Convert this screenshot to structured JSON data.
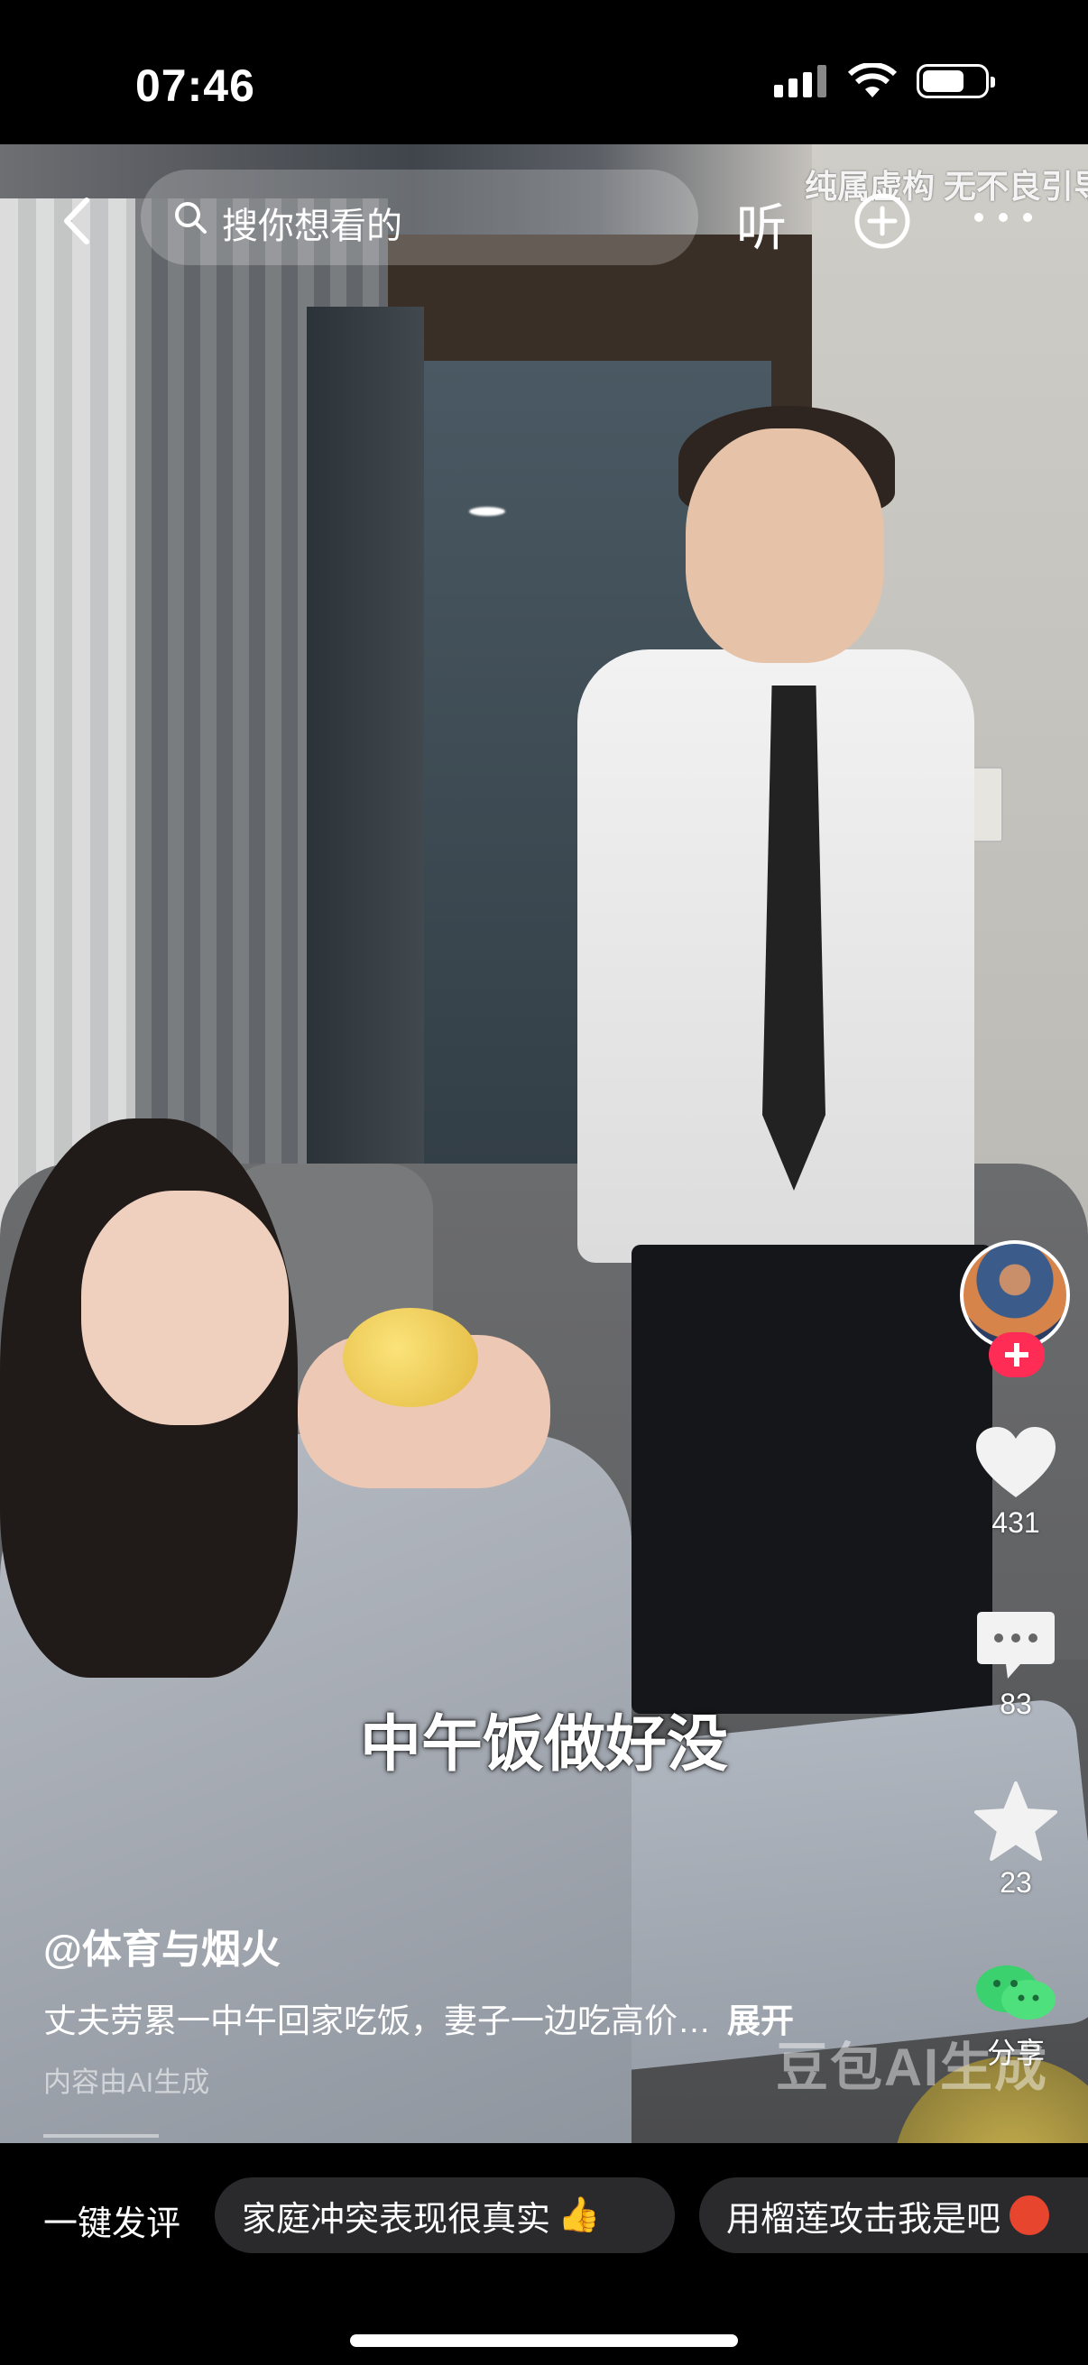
{
  "status_bar": {
    "time": "07:46",
    "icons": [
      "signal-icon",
      "wifi-icon",
      "battery-icon"
    ]
  },
  "top_nav": {
    "search_placeholder": "搜你想看的",
    "listen_label": "听",
    "watermark": "纯属虚构 无不良引导"
  },
  "rail": {
    "like_count": "431",
    "comment_count": "83",
    "favorite_count": "23",
    "share_label": "分享"
  },
  "video": {
    "subtitle": "中午饭做好没",
    "author": "@体育与烟火",
    "description": "丈夫劳累一中午回家吃饭，妻子一边吃高价…",
    "expand_label": "展开",
    "ai_note": "内容由AI生成",
    "watermark": "豆包AI生成"
  },
  "quick_comments": {
    "label": "一键发评",
    "chips": [
      {
        "text": "家庭冲突表现很真实",
        "emoji": "thumbs-up"
      },
      {
        "text": "用榴莲攻击我是吧",
        "emoji": "angry-face"
      }
    ]
  },
  "colors": {
    "accent": "#ff2d55",
    "chip_bg": "#2a2a2d"
  }
}
